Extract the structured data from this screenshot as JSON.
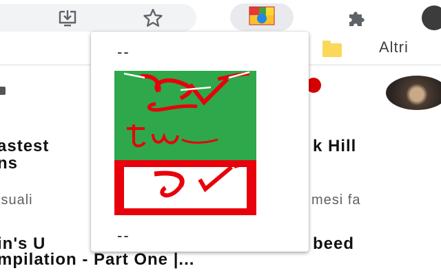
{
  "toolbar": {
    "install_icon": "download-install-icon",
    "bookmark_icon": "star-outline-icon",
    "extension_icon": "colorful-extension-icon",
    "extensions_menu_icon": "puzzle-icon"
  },
  "bookmarks_bar": {
    "folder_icon": "folder-icon",
    "other_label": "Altri"
  },
  "background_page": {
    "line1_left": "astest",
    "line1_right": "k Hill",
    "line2_left": "ns",
    "line3_left": "isuali",
    "line3_right": "mesi fa",
    "line4_left": "in's U",
    "line4_right": "beed",
    "line5_left": "mpilation - Part One |..."
  },
  "popup": {
    "top_separator": "--",
    "bottom_separator": "--",
    "logo_green": "#2ea84a",
    "logo_red": "#e8000b",
    "logo_icon": "youtube-tw-logo-icon"
  },
  "colors": {
    "toolbar_bg": "#ffffff",
    "omnibox_bg": "#f1f3f4",
    "icon_gray": "#5f6368",
    "folder_yellow": "#f9d85a"
  }
}
